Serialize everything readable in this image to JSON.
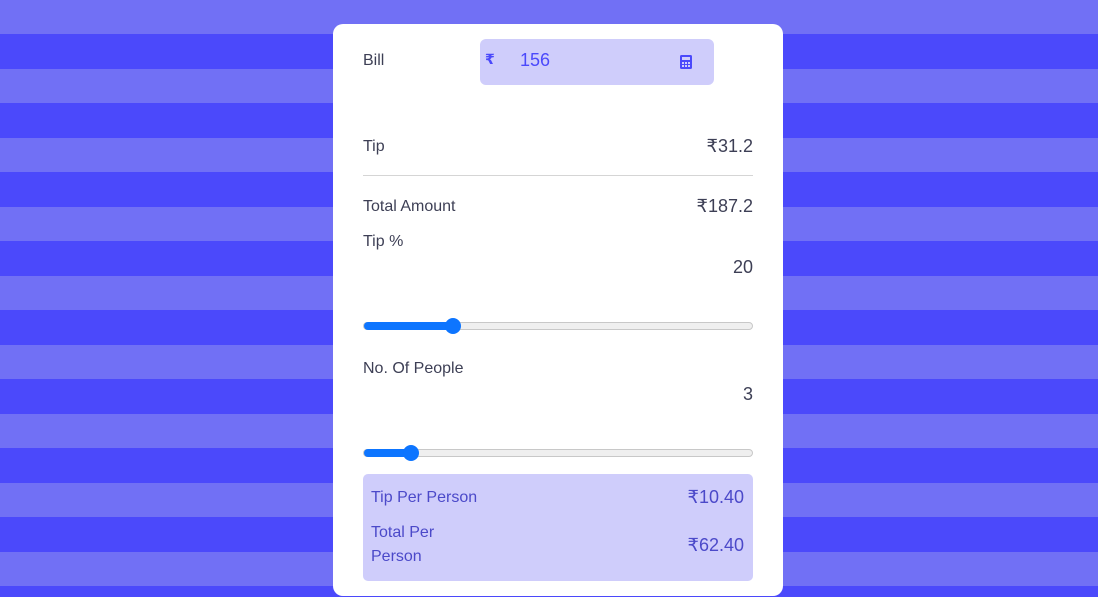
{
  "bill": {
    "label": "Bill",
    "currency_symbol": "₹",
    "value": "156",
    "icon": "calculator-icon"
  },
  "tip": {
    "label": "Tip",
    "value": "₹31.2"
  },
  "total": {
    "label": "Total Amount",
    "value": "₹187.2"
  },
  "tip_percent": {
    "label": "Tip %",
    "value": "20",
    "slider_fraction": 0.23
  },
  "people": {
    "label": "No. Of People",
    "value": "3",
    "slider_fraction": 0.12
  },
  "summary": {
    "tip_per_person_label": "Tip Per Person",
    "tip_per_person_value": "₹10.40",
    "total_per_person_label_line1": "Total Per",
    "total_per_person_label_line2": "Person",
    "total_per_person_value": "₹62.40"
  },
  "colors": {
    "accent": "#4b49fb",
    "stripe_light": "#7170f5",
    "slider": "#0d75ff",
    "summary_bg": "#cfcdfb"
  }
}
